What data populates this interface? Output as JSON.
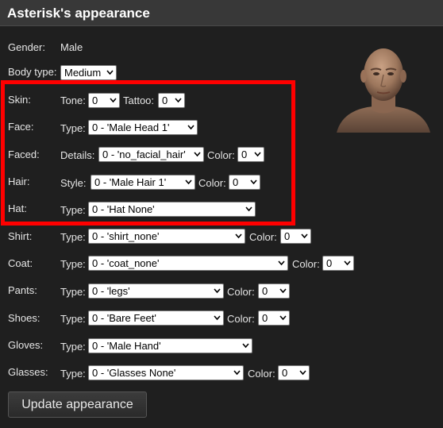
{
  "title": "Asterisk's appearance",
  "gender": {
    "label": "Gender:",
    "value": "Male"
  },
  "body_type": {
    "label": "Body type:",
    "value": "Medium"
  },
  "skin": {
    "label": "Skin:",
    "tone_label": "Tone:",
    "tone": "0",
    "tattoo_label": "Tattoo:",
    "tattoo": "0"
  },
  "face": {
    "label": "Face:",
    "type_label": "Type:",
    "type": "0 - 'Male Head 1'"
  },
  "faced": {
    "label": "Faced:",
    "details_label": "Details:",
    "details": "0 - 'no_facial_hair'",
    "color_label": "Color:",
    "color": "0"
  },
  "hair": {
    "label": "Hair:",
    "style_label": "Style:",
    "style": "0 - 'Male Hair 1'",
    "color_label": "Color:",
    "color": "0"
  },
  "hat": {
    "label": "Hat:",
    "type_label": "Type:",
    "type": "0 - 'Hat None'"
  },
  "shirt": {
    "label": "Shirt:",
    "type_label": "Type:",
    "type": "0 - 'shirt_none'",
    "color_label": "Color:",
    "color": "0"
  },
  "coat": {
    "label": "Coat:",
    "type_label": "Type:",
    "type": "0 - 'coat_none'",
    "color_label": "Color:",
    "color": "0"
  },
  "pants": {
    "label": "Pants:",
    "type_label": "Type:",
    "type": "0 - 'legs'",
    "color_label": "Color:",
    "color": "0"
  },
  "shoes": {
    "label": "Shoes:",
    "type_label": "Type:",
    "type": "0 - 'Bare Feet'",
    "color_label": "Color:",
    "color": "0"
  },
  "gloves": {
    "label": "Gloves:",
    "type_label": "Type:",
    "type": "0 - 'Male Hand'"
  },
  "glasses": {
    "label": "Glasses:",
    "type_label": "Type:",
    "type": "0 - 'Glasses None'",
    "color_label": "Color:",
    "color": "0"
  },
  "update_button": "Update appearance",
  "colors": {
    "highlight": "#ff0000",
    "background": "#1f1f1f",
    "titlebar": "#383838"
  },
  "icons": {
    "dropdown": "chevron-down-icon",
    "avatar": "character-head-portrait"
  }
}
